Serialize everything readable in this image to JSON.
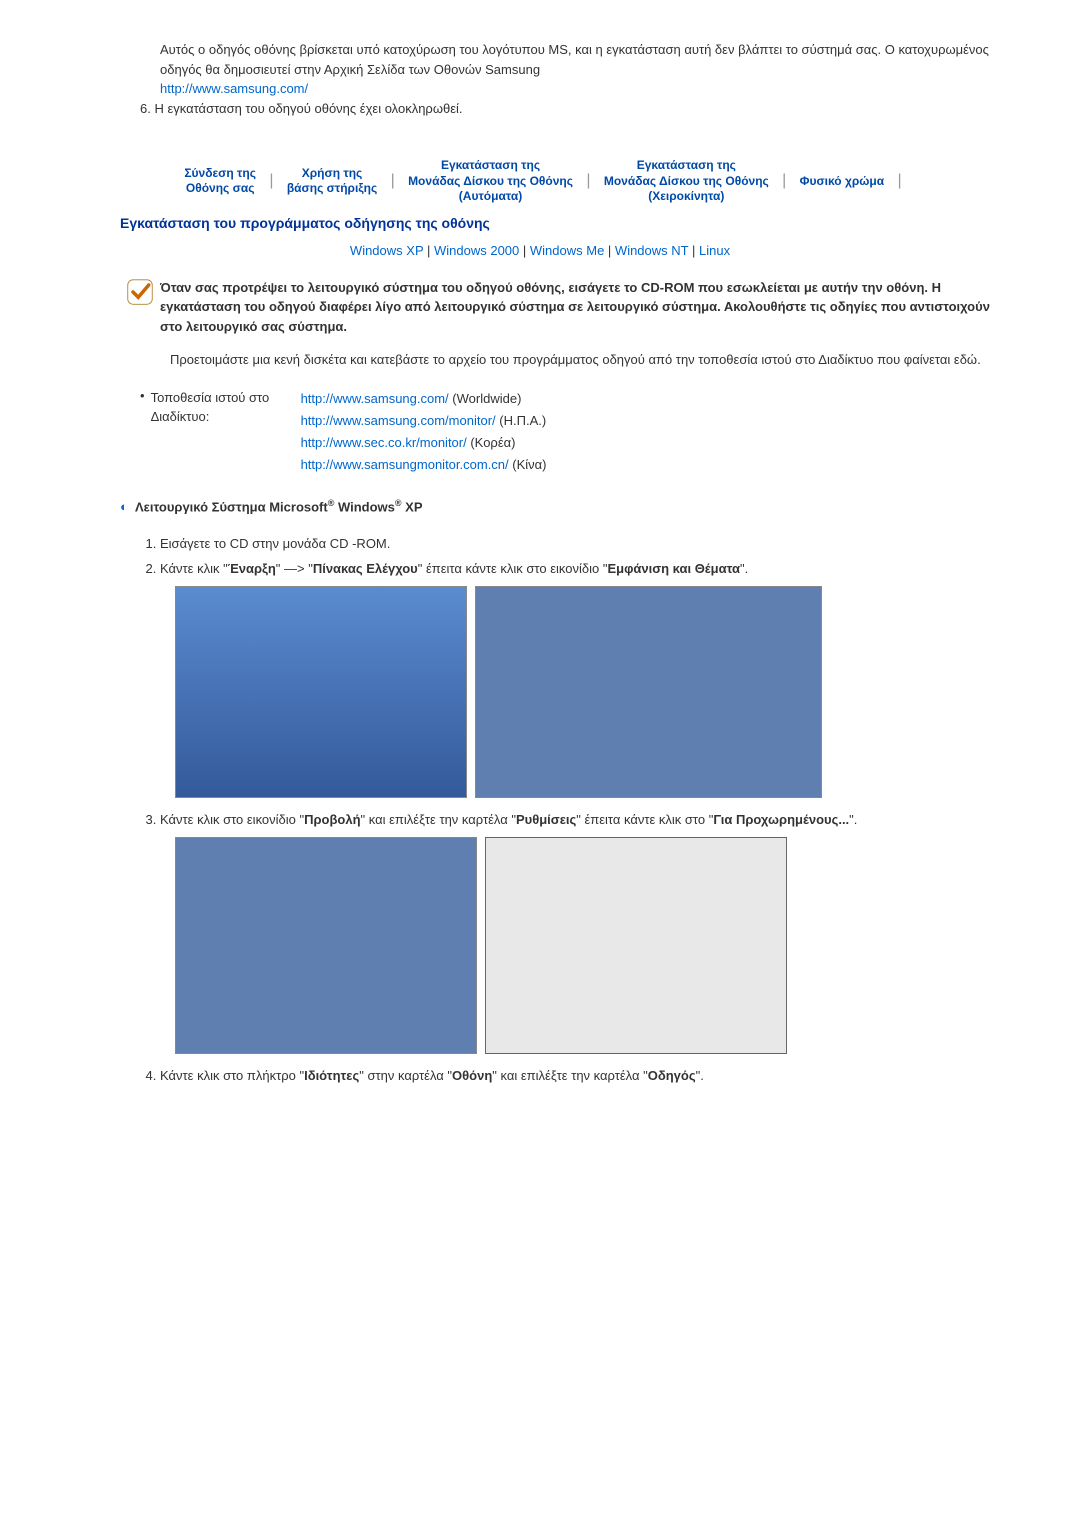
{
  "intro": {
    "para1": "Αυτός ο οδηγός οθόνης βρίσκεται υπό κατοχύρωση του λογότυπου MS, και η εγκατάσταση αυτή δεν βλάπτει το σύστημά σας. Ο κατοχυρωμένος οδηγός θα δημοσιευτεί στην Αρχική Σελίδα των Οθονών Samsung",
    "samsung_url": "http://www.samsung.com/",
    "item6": "6.  Η εγκατάσταση του οδηγού οθόνης έχει ολοκληρωθεί."
  },
  "navbar": {
    "items": [
      "Σύνδεση της\nΟθόνης σας",
      "Χρήση της\nβάσης στήριξης",
      "Εγκατάσταση της\nΜονάδας Δίσκου της Οθόνης\n(Αυτόματα)",
      "Εγκατάσταση της\nΜονάδας Δίσκου της Οθόνης\n(Χειροκίνητα)",
      "Φυσικό χρώμα"
    ]
  },
  "section1_heading": "Εγκατάσταση του προγράμματος οδήγησης της οθόνης",
  "os_links": {
    "items": [
      "Windows XP",
      "Windows 2000",
      "Windows Me",
      "Windows NT",
      "Linux"
    ]
  },
  "info_box": "Όταν σας προτρέψει το λειτουργικό σύστημα του οδηγού οθόνης, εισάγετε το CD-ROM που εσωκλείεται με αυτήν την οθόνη. Η εγκατάσταση του οδηγού διαφέρει λίγο από λειτουργικό σύστημα σε λειτουργικό σύστημα. Ακολουθήστε τις οδηγίες που αντιστοιχούν στο λειτουργικό σας σύστημα.",
  "note": "Προετοιμάστε μια κενή δισκέτα και κατεβάστε το αρχείο του προγράμματος οδηγού από την τοποθεσία ιστού στο Διαδίκτυο που φαίνεται εδώ.",
  "bullet_label": "Τοποθεσία ιστού στο Διαδίκτυο:",
  "urls": [
    {
      "href": "http://www.samsung.com/",
      "tail": " (Worldwide)"
    },
    {
      "href": "http://www.samsung.com/monitor/",
      "tail": " (Η.Π.Α.)"
    },
    {
      "href": "http://www.sec.co.kr/monitor/",
      "tail": " (Κορέα)"
    },
    {
      "href": "http://www.samsungmonitor.com.cn/",
      "tail": " (Κίνα)"
    }
  ],
  "subheading": {
    "prefix": "Λειτουργικό Σύστημα Microsoft",
    "mid": " Windows",
    "suffix": " XP"
  },
  "steps": {
    "s1": "Εισάγετε το CD στην μονάδα CD -ROM.",
    "s2_a": "Κάντε κλικ \"",
    "s2_b": "Έναρξη",
    "s2_c": "\" —> \"",
    "s2_d": "Πίνακας Ελέγχου",
    "s2_e": "\" έπειτα κάντε κλικ στο εικονίδιο \"",
    "s2_f": "Εμφάνιση και Θέματα",
    "s2_g": "\".",
    "s3_a": "Κάντε κλικ στο εικονίδιο \"",
    "s3_b": "Προβολή",
    "s3_c": "\" και επιλέξτε την καρτέλα \"",
    "s3_d": "Ρυθμίσεις",
    "s3_e": "\" έπειτα κάντε κλικ στο \"",
    "s3_f": "Για Προχωρημένους...",
    "s3_g": "\".",
    "s4_a": "Κάντε κλικ στο πλήκτρο \"",
    "s4_b": "Ιδιότητες",
    "s4_c": "\" στην καρτέλα \"",
    "s4_d": "Οθόνη",
    "s4_e": "\" και επιλέξτε την καρτέλα \"",
    "s4_f": "Οδηγός",
    "s4_g": "\"."
  }
}
